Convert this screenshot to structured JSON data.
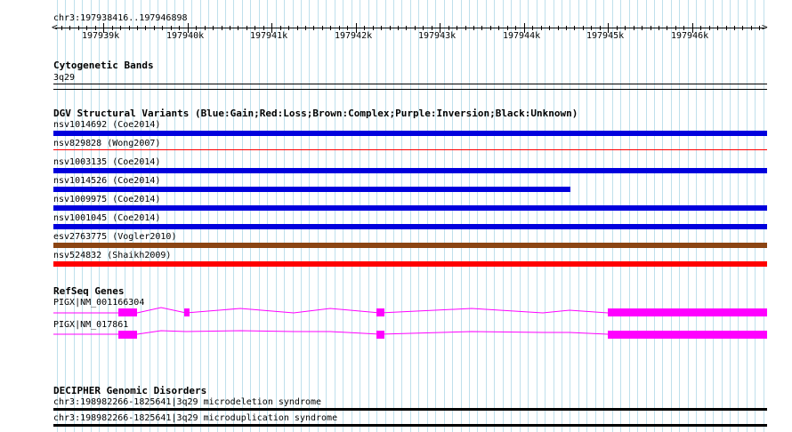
{
  "ruler": {
    "region_label": "chr3:197938416..197946898",
    "ticks": [
      "197939k",
      "197940k",
      "197941k",
      "197942k",
      "197943k",
      "197944k",
      "197945k",
      "197946k"
    ]
  },
  "cytoband_track": {
    "title": "Cytogenetic Bands",
    "band_label": "3q29"
  },
  "dgv_track": {
    "title": "DGV Structural Variants (Blue:Gain;Red:Loss;Brown:Complex;Purple:Inversion;Black:Unknown)",
    "features": [
      {
        "label": "nsv1014692 (Coe2014)",
        "color": "#0000dd",
        "type": "gain",
        "end_fraction": 1.0
      },
      {
        "label": "nsv829828 (Wong2007)",
        "color": "#ff0000",
        "type": "loss",
        "end_fraction": 1.0
      },
      {
        "label": "nsv1003135 (Coe2014)",
        "color": "#0000dd",
        "type": "gain",
        "end_fraction": 1.0
      },
      {
        "label": "nsv1014526 (Coe2014)",
        "color": "#0000dd",
        "type": "gain",
        "end_fraction": 0.725
      },
      {
        "label": "nsv1009975 (Coe2014)",
        "color": "#0000dd",
        "type": "gain",
        "end_fraction": 1.0
      },
      {
        "label": "nsv1001045 (Coe2014)",
        "color": "#0000dd",
        "type": "gain",
        "end_fraction": 1.0
      },
      {
        "label": "esv2763775 (Vogler2010)",
        "color": "#8b4513",
        "type": "complex",
        "end_fraction": 1.0
      },
      {
        "label": "nsv524832 (Shaikh2009)",
        "color": "#ff0000",
        "type": "loss",
        "end_fraction": 1.0
      }
    ]
  },
  "refseq_track": {
    "title": "RefSeq Genes",
    "color": "#ff00ff",
    "transcripts": [
      {
        "label": "PIGX|NM_001166304"
      },
      {
        "label": "PIGX|NM_017861"
      }
    ]
  },
  "decipher_track": {
    "title": "DECIPHER Genomic Disorders",
    "features": [
      {
        "label": "chr3:198982266-1825641|3q29 microdeletion syndrome",
        "color": "#000000"
      },
      {
        "label": "chr3:198982266-1825641|3q29 microduplication syndrome",
        "color": "#000000"
      }
    ]
  }
}
